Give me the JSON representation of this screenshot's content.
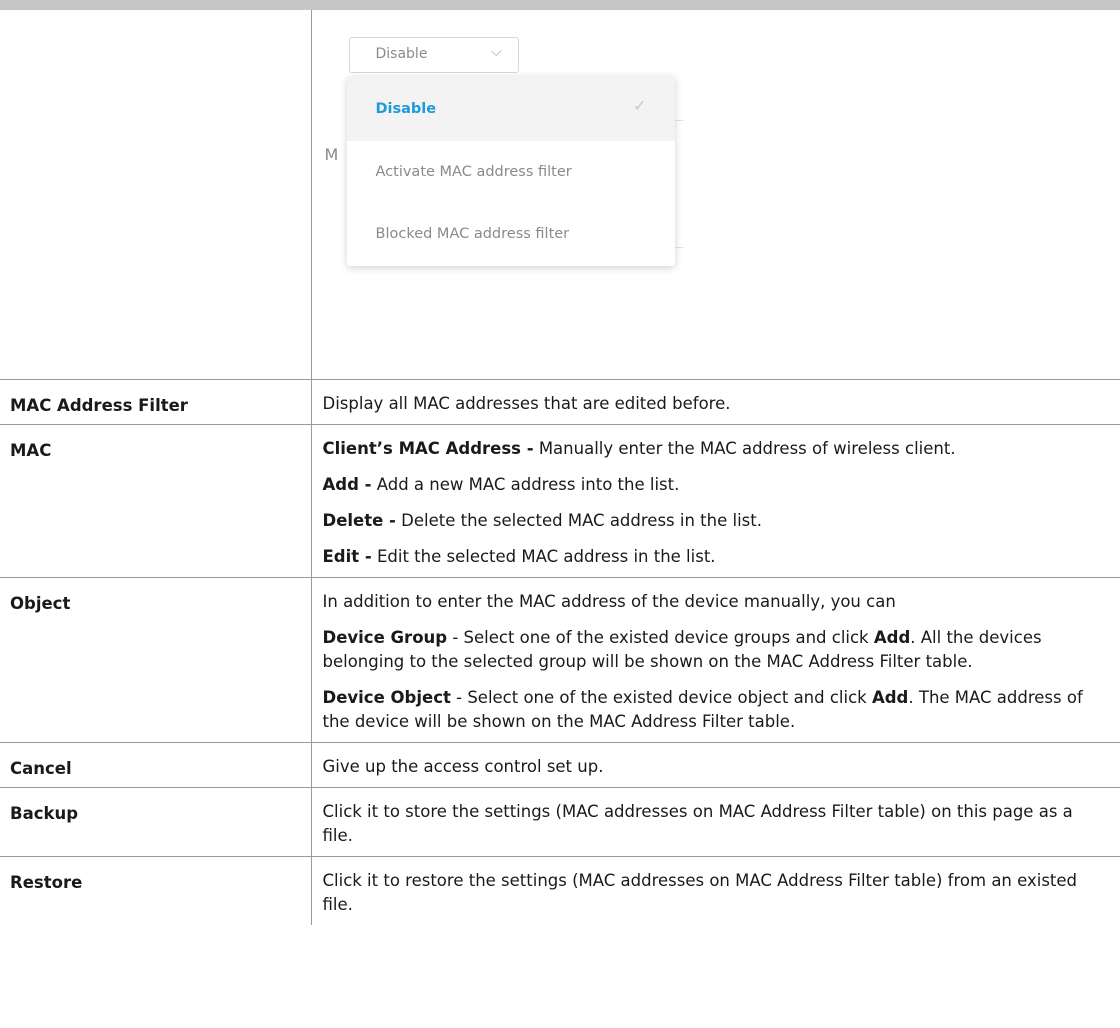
{
  "dropdown": {
    "selected": "Disable",
    "options": [
      {
        "label": "Disable",
        "active": true
      },
      {
        "label": "Activate MAC address filter",
        "active": false
      },
      {
        "label": "Blocked MAC address filter",
        "active": false
      }
    ],
    "ghost_text": "M",
    "accent": "#1f9ad8"
  },
  "rows": [
    {
      "term": "MAC Address Filter",
      "desc": "Display all MAC addresses that are edited before."
    },
    {
      "term": "MAC",
      "p1_b": "Client’s MAC Address -",
      "p1": " Manually enter the MAC address of wireless client.",
      "p2_b": "Add -",
      "p2": " Add a new MAC address into the list.",
      "p3_b": "Delete -",
      "p3": " Delete the selected MAC address in the list.",
      "p4_b": "Edit -",
      "p4": " Edit the selected MAC address in the list."
    },
    {
      "term": "Object",
      "p1": "In addition to enter the MAC address of the device manually, you can",
      "p2_b": "Device Group",
      "p2": " - Select one of the existed device groups and click ",
      "p2_b2": "Add",
      "p2_end": ". All the devices belonging to the selected group will be shown on the MAC Address Filter table.",
      "p3_b": "Device Object",
      "p3": " - Select one of the existed device object and click ",
      "p3_b2": "Add",
      "p3_end": ". The MAC address of the device will be shown on the MAC Address Filter table."
    },
    {
      "term": "Cancel",
      "desc": "Give up the access control set up."
    },
    {
      "term": "Backup",
      "desc": "Click it to store the settings (MAC addresses on MAC Address Filter table) on this page as a file."
    },
    {
      "term": "Restore",
      "desc": "Click it to restore the settings (MAC addresses on MAC Address Filter table) from an existed file."
    }
  ]
}
